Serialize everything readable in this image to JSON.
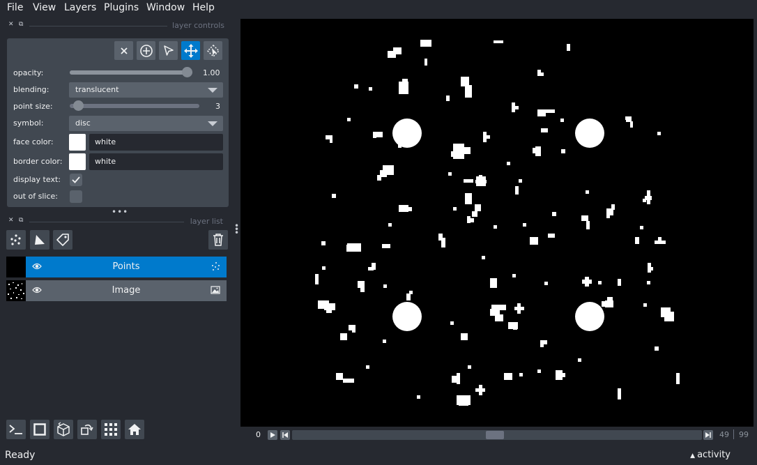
{
  "menu": [
    {
      "label": "File"
    },
    {
      "label": "View"
    },
    {
      "label": "Layers"
    },
    {
      "label": "Plugins"
    },
    {
      "label": "Window"
    },
    {
      "label": "Help"
    }
  ],
  "layer_controls": {
    "title": "layer controls",
    "opacity_label": "opacity:",
    "opacity_value": "1.00",
    "opacity_fraction": 1.0,
    "blending_label": "blending:",
    "blending_value": "translucent",
    "point_size_label": "point size:",
    "point_size_value": "3",
    "point_size_fraction": 0.03,
    "symbol_label": "symbol:",
    "symbol_value": "disc",
    "face_color_label": "face color:",
    "face_color_value": "white",
    "border_color_label": "border color:",
    "border_color_value": "white",
    "display_text_label": "display text:",
    "display_text_checked": true,
    "out_of_slice_label": "out of slice:",
    "out_of_slice_checked": false
  },
  "layer_list": {
    "title": "layer list",
    "layers": [
      {
        "name": "Points",
        "type": "points",
        "selected": true,
        "visible": true
      },
      {
        "name": "Image",
        "type": "image",
        "selected": false,
        "visible": true
      }
    ]
  },
  "dims": {
    "current": "0",
    "slider_value": "49",
    "slider_max": "99"
  },
  "status": {
    "text": "Ready",
    "activity": "activity"
  },
  "colors": {
    "accent": "#007acc",
    "background": "#262930",
    "panel": "#414851",
    "button": "#5a626c"
  }
}
